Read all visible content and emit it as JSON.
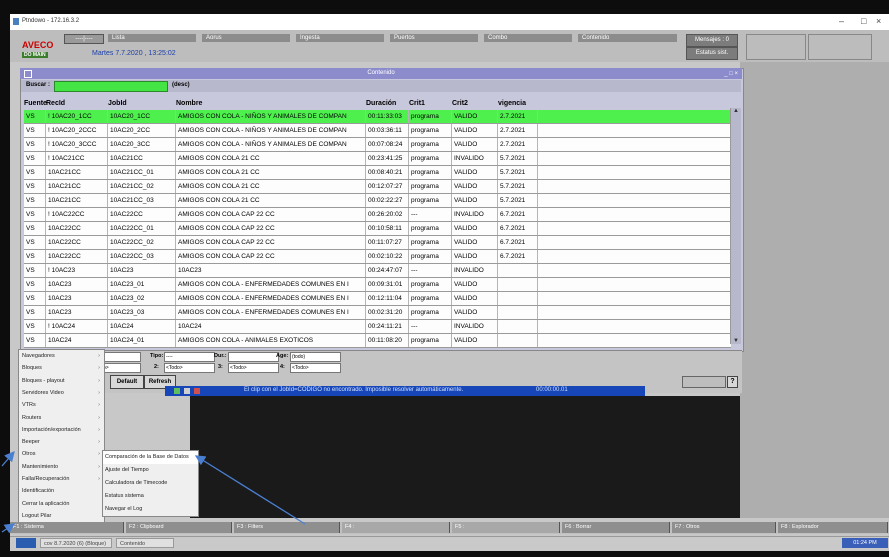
{
  "window": {
    "title": "Ptndowo - 172.16.3.2",
    "controls": [
      "–",
      "□",
      "×"
    ]
  },
  "header": {
    "logo_text": "AVECO",
    "logo_sub": "DO MAIN",
    "top_input": "----|----",
    "nav": [
      "Lista",
      "Aorus",
      "Ingesta",
      "Puertos",
      "Combo",
      "Contenido"
    ],
    "datetime": "Martes 7.7.2020 , 13:25:02",
    "messages_button": "Mensajes : 0",
    "status_button": "Estatus sist."
  },
  "panel": {
    "title": "Contenido",
    "search_label": "Buscar :",
    "search_value": "",
    "search_hint": "(desc)",
    "columns": [
      "Fuente",
      "RecId",
      "JobId",
      "Nombre",
      "Duración",
      "Crit1",
      "Crit2",
      "vigencia"
    ],
    "rows": [
      [
        "VS",
        "! 10AC20_1CC",
        "10AC20_1CC",
        "AMIGOS CON COLA - NIÑOS Y ANIMALES DE COMPAN",
        "00:11:33:03",
        "programa",
        "VALIDO",
        "2.7.2021"
      ],
      [
        "VS",
        "! 10AC20_2CCC",
        "10AC20_2CC",
        "AMIGOS CON COLA - NIÑOS Y ANIMALES DE COMPAN",
        "00:03:36:11",
        "programa",
        "VALIDO",
        "2.7.2021"
      ],
      [
        "VS",
        "! 10AC20_3CCC",
        "10AC20_3CC",
        "AMIGOS CON COLA - NIÑOS Y ANIMALES DE COMPAN",
        "00:07:08:24",
        "programa",
        "VALIDO",
        "2.7.2021"
      ],
      [
        "VS",
        "! 10AC21CC",
        "10AC21CC",
        "AMIGOS CON COLA 21 CC",
        "00:23:41:25",
        "programa",
        "INVALIDO",
        "5.7.2021"
      ],
      [
        "VS",
        "10AC21CC",
        "10AC21CC_01",
        "AMIGOS CON COLA 21 CC",
        "00:08:40:21",
        "programa",
        "VALIDO",
        "5.7.2021"
      ],
      [
        "VS",
        "10AC21CC",
        "10AC21CC_02",
        "AMIGOS CON COLA 21 CC",
        "00:12:07:27",
        "programa",
        "VALIDO",
        "5.7.2021"
      ],
      [
        "VS",
        "10AC21CC",
        "10AC21CC_03",
        "AMIGOS CON COLA 21 CC",
        "00:02:22:27",
        "programa",
        "VALIDO",
        "5.7.2021"
      ],
      [
        "VS",
        "! 10AC22CC",
        "10AC22CC",
        "AMIGOS CON COLA CAP 22 CC",
        "00:26:20:02",
        "---",
        "INVALIDO",
        "6.7.2021"
      ],
      [
        "VS",
        "10AC22CC",
        "10AC22CC_01",
        "AMIGOS CON COLA CAP 22 CC",
        "00:10:58:11",
        "programa",
        "VALIDO",
        "6.7.2021"
      ],
      [
        "VS",
        "10AC22CC",
        "10AC22CC_02",
        "AMIGOS CON COLA CAP 22 CC",
        "00:11:07:27",
        "programa",
        "VALIDO",
        "6.7.2021"
      ],
      [
        "VS",
        "10AC22CC",
        "10AC22CC_03",
        "AMIGOS CON COLA CAP 22 CC",
        "00:02:10:22",
        "programa",
        "VALIDO",
        "6.7.2021"
      ],
      [
        "VS",
        "! 10AC23",
        "10AC23",
        "10AC23",
        "00:24:47:07",
        "---",
        "INVALIDO",
        ""
      ],
      [
        "VS",
        "10AC23",
        "10AC23_01",
        "AMIGOS CON COLA - ENFERMEDADES COMUNES EN I",
        "00:09:31:01",
        "programa",
        "VALIDO",
        ""
      ],
      [
        "VS",
        "10AC23",
        "10AC23_02",
        "AMIGOS CON COLA - ENFERMEDADES COMUNES EN I",
        "00:12:11:04",
        "programa",
        "VALIDO",
        ""
      ],
      [
        "VS",
        "10AC23",
        "10AC23_03",
        "AMIGOS CON COLA - ENFERMEDADES COMUNES EN I",
        "00:02:31:20",
        "programa",
        "VALIDO",
        ""
      ],
      [
        "VS",
        "! 10AC24",
        "10AC24",
        "10AC24",
        "00:24:11:21",
        "---",
        "INVALIDO",
        ""
      ],
      [
        "VS",
        "10AC24",
        "10AC24_01",
        "AMIGOS CON COLA - ANIMALES EXOTICOS",
        "00:11:08:20",
        "programa",
        "VALIDO",
        ""
      ]
    ],
    "selected_row": 0
  },
  "filters": {
    "row1": [
      {
        "label": "m:",
        "value": "----"
      },
      {
        "label": "Tipo:",
        "value": "----"
      },
      {
        "label": "Dur.:",
        "value": ""
      },
      {
        "label": "Age:",
        "value": "(todo)"
      }
    ],
    "row2": [
      {
        "label": "",
        "value": "<Todo>"
      },
      {
        "label": "2:",
        "value": "<Todo>"
      },
      {
        "label": "3:",
        "value": "<Todo>"
      },
      {
        "label": "4:",
        "value": "<Todo>"
      }
    ],
    "default_button": "Default",
    "refresh_button": "Refresh",
    "help_button": "?"
  },
  "status_message": {
    "text": "El clip con el JobId=CODIGO no encontrado. Imposible resolver automáticamente.",
    "time": "00:00:00.01"
  },
  "main_menu": [
    "Navegadores",
    "Bloques",
    "Bloques - playout",
    "Servidores Video",
    "VTRs",
    "Routers",
    "Importación/exportación",
    "Beeper",
    "Otros",
    "Mantenimiento",
    "Falla/Recuperación",
    "Identificación",
    "Cerrar la aplicación",
    "Logout Pilar"
  ],
  "submenu": [
    "Comparación de la Base de Datos",
    "Ajuste del Tiempo",
    "Calculadora de Timecode",
    "Estatus sistema",
    "Navegar el Log"
  ],
  "fkeys": [
    "F1 : Sistema",
    "F2 : Clipboard",
    "F3 : Filters",
    "F4 :",
    "F5 :",
    "F6 : Borrar",
    "F7 : Otros",
    "F8 : Explorador"
  ],
  "taskbar": {
    "item1": "cov 8.7.2020 (6) (Bloque)",
    "item2": "Contenido",
    "clock": "01:24 PM"
  },
  "colors": {
    "selected_row": "#4ef04e",
    "search_field": "#44e444",
    "title_bar": "#8c8ccc",
    "annotation_arrow": "#4a7fd0"
  }
}
